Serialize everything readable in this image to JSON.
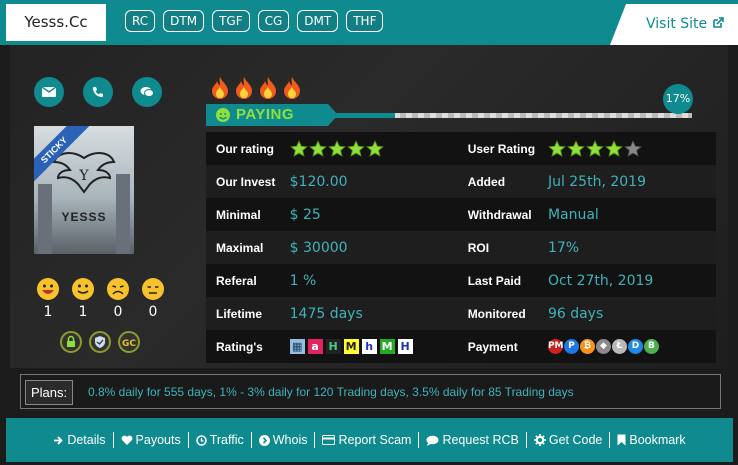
{
  "header": {
    "brand": "Yesss.Cc",
    "tags": [
      "RC",
      "DTM",
      "TGF",
      "CG",
      "DMT",
      "THF"
    ],
    "visit": "Visit Site"
  },
  "logo": {
    "name": "YESSS",
    "sticky": "STICKY"
  },
  "votes": [
    {
      "icon": "happy-icon",
      "count": "1"
    },
    {
      "icon": "smile-icon",
      "count": "1"
    },
    {
      "icon": "sad-icon",
      "count": "0"
    },
    {
      "icon": "neutral-icon",
      "count": "0"
    }
  ],
  "status": {
    "label": "PAYING",
    "progress_pct": 17,
    "progress_text": "17%"
  },
  "details": [
    {
      "label": "Our rating",
      "value": "",
      "type": "stars",
      "rating": 5,
      "label2": "User Rating",
      "value2": "",
      "type2": "stars",
      "rating2": 4
    },
    {
      "label": "Our Invest",
      "value": "$120.00",
      "label2": "Added",
      "value2": "Jul 25th, 2019"
    },
    {
      "label": "Minimal",
      "value": "$ 25",
      "label2": "Withdrawal",
      "value2": "Manual"
    },
    {
      "label": "Maximal",
      "value": "$ 30000",
      "label2": "ROI",
      "value2": "17%"
    },
    {
      "label": "Referal",
      "value": "1 %",
      "label2": "Last Paid",
      "value2": "Oct 27th, 2019"
    },
    {
      "label": "Lifetime",
      "value": "1475 days",
      "label2": "Monitored",
      "value2": "96 days"
    },
    {
      "label": "Rating's",
      "value": "",
      "type": "ratings",
      "label2": "Payment",
      "value2": "",
      "type2": "payment"
    }
  ],
  "plans": {
    "label": "Plans:",
    "text": "0.8% daily for 555 days, 1% - 3% daily for 120 Trading days, 3.5% daily for 85 Trading days"
  },
  "footer": [
    {
      "label": "Details",
      "icon": "arrow-right-icon"
    },
    {
      "label": "Payouts",
      "icon": "heart-icon"
    },
    {
      "label": "Traffic",
      "icon": "clock-icon"
    },
    {
      "label": "Whois",
      "icon": "chevron-circle-icon"
    },
    {
      "label": "Report Scam",
      "icon": "card-icon"
    },
    {
      "label": "Request RCB",
      "icon": "comment-icon"
    },
    {
      "label": "Get Code",
      "icon": "gear-icon"
    },
    {
      "label": "Bookmark",
      "icon": "bookmark-icon"
    }
  ],
  "colors": {
    "accent": "#0f8a8e",
    "value_text": "#3fb3ba",
    "paying": "#8fe03a"
  }
}
